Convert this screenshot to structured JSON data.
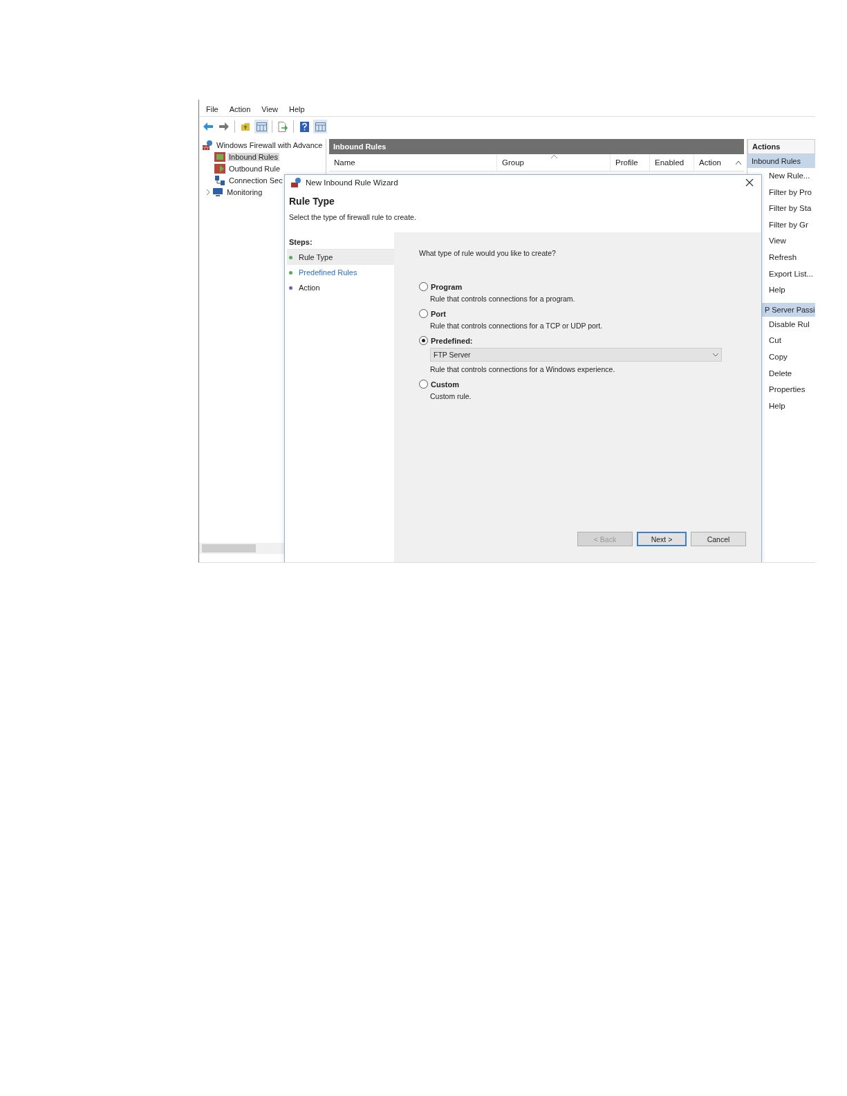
{
  "menu": [
    "File",
    "Action",
    "View",
    "Help"
  ],
  "toolbar": [
    {
      "kind": "back"
    },
    {
      "kind": "forward"
    },
    {
      "kind": "sep"
    },
    {
      "kind": "folder"
    },
    {
      "kind": "grid"
    },
    {
      "kind": "sep"
    },
    {
      "kind": "export"
    },
    {
      "kind": "sep"
    },
    {
      "kind": "help"
    },
    {
      "kind": "grid"
    }
  ],
  "tree": [
    {
      "label": "Windows Firewall with Advance",
      "selected": false,
      "children": [
        {
          "label": "Inbound Rules",
          "selected": true
        },
        {
          "label": "Outbound Rule",
          "selected": false
        },
        {
          "label": "Connection Sec",
          "selected": false
        },
        {
          "label": "Monitoring",
          "selected": false,
          "expanded": false
        }
      ]
    }
  ],
  "rules": {
    "title": "Inbound Rules",
    "columns": [
      {
        "label": "Name",
        "sorted": false
      },
      {
        "label": "Group",
        "sorted": true
      },
      {
        "label": "Profile",
        "sorted": false
      },
      {
        "label": "Enabled",
        "sorted": false
      },
      {
        "label": "Action",
        "sorted": false
      }
    ]
  },
  "actions": {
    "title": "Actions",
    "sections": [
      {
        "title": "Inbound Rules",
        "items": [
          "New Rule...",
          "Filter by Pro",
          "Filter by Sta",
          "Filter by Gr",
          "View",
          "Refresh",
          "Export List...",
          "Help"
        ]
      },
      {
        "title": "P Server Passi",
        "items": [
          "Disable Rul",
          "Cut",
          "Copy",
          "Delete",
          "Properties",
          "Help"
        ]
      }
    ]
  },
  "wizard": {
    "title": "New Inbound Rule Wizard",
    "heading": "Rule Type",
    "subtitle": "Select the type of firewall rule to create.",
    "steps_title": "Steps:",
    "steps": [
      {
        "label": "Rule Type",
        "selected": true,
        "hovered": false,
        "color": "#4caf50"
      },
      {
        "label": "Predefined Rules",
        "selected": false,
        "hovered": true,
        "color": "#4caf50"
      },
      {
        "label": "Action",
        "selected": false,
        "hovered": false,
        "color": "#6a5acd"
      }
    ],
    "question": "What type of rule would you like to create?",
    "options": [
      {
        "label": "Program",
        "description": "Rule that controls connections for a program.",
        "selected": false
      },
      {
        "label": "Port",
        "description": "Rule that controls connections for a TCP or UDP port.",
        "selected": false
      },
      {
        "label": "Predefined:",
        "dropdown": "FTP Server",
        "description": "Rule that controls connections for a Windows experience.",
        "selected": true
      },
      {
        "label": "Custom",
        "description": "Custom rule.",
        "selected": false
      }
    ],
    "buttons": [
      {
        "label": "< Back",
        "disabled": true,
        "default": false
      },
      {
        "label": "Next >",
        "disabled": false,
        "default": true
      },
      {
        "label": "Cancel",
        "disabled": false,
        "default": false
      }
    ]
  }
}
